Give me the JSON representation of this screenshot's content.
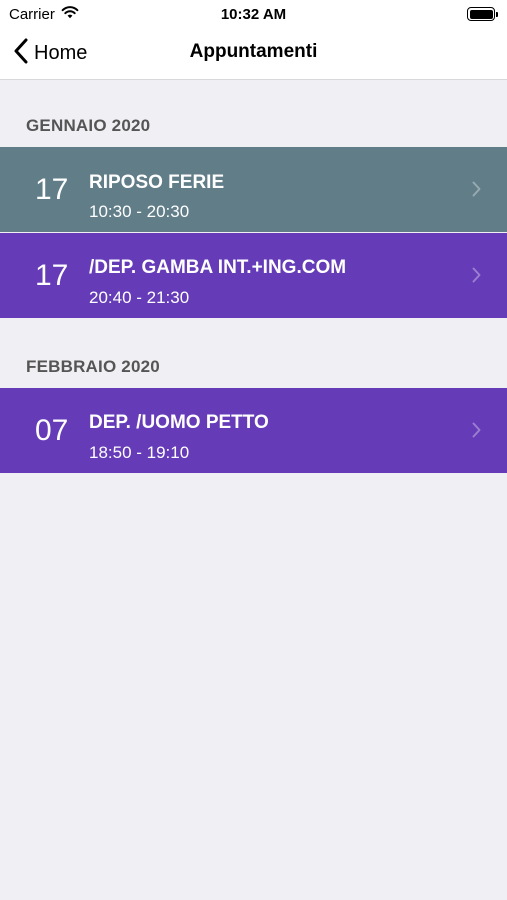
{
  "status_bar": {
    "carrier": "Carrier",
    "time": "10:32 AM"
  },
  "nav": {
    "back_label": "Home",
    "title": "Appuntamenti"
  },
  "colors": {
    "grey_row": "#607d88",
    "purple_row": "#653bb8",
    "background": "#efeff4"
  },
  "sections": [
    {
      "header": "GENNAIO 2020",
      "rows": [
        {
          "day": "17",
          "title": " RIPOSO FERIE",
          "time": "10:30 - 20:30",
          "color": "#607d88"
        },
        {
          "day": "17",
          "title": "/DEP. GAMBA INT.+ING.COM",
          "time": "20:40 - 21:30",
          "color": "#653bb8"
        }
      ]
    },
    {
      "header": "FEBBRAIO 2020",
      "rows": [
        {
          "day": "07",
          "title": "DEP. /UOMO PETTO",
          "time": "18:50 - 19:10",
          "color": "#653bb8"
        }
      ]
    }
  ]
}
